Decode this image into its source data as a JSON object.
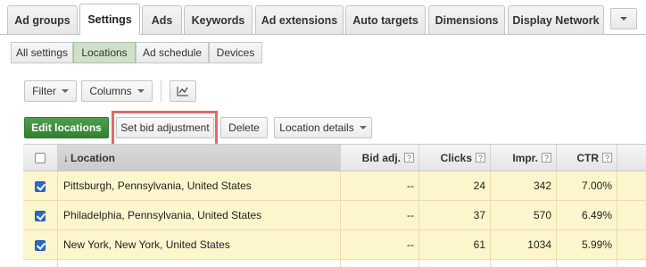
{
  "tabs": [
    {
      "label": "Ad groups"
    },
    {
      "label": "Settings"
    },
    {
      "label": "Ads"
    },
    {
      "label": "Keywords"
    },
    {
      "label": "Ad extensions"
    },
    {
      "label": "Auto targets"
    },
    {
      "label": "Dimensions"
    },
    {
      "label": "Display Network"
    }
  ],
  "active_tab": "Settings",
  "subtabs": [
    {
      "label": "All settings"
    },
    {
      "label": "Locations"
    },
    {
      "label": "Ad schedule"
    },
    {
      "label": "Devices"
    }
  ],
  "active_subtab": "Locations",
  "toolbar": {
    "filter_label": "Filter",
    "columns_label": "Columns",
    "chart_icon": "line-chart-icon"
  },
  "actions": {
    "edit_locations": "Edit locations",
    "set_bid_adjustment": "Set bid adjustment",
    "delete": "Delete",
    "location_details": "Location details"
  },
  "table": {
    "columns": [
      "Location",
      "Bid adj.",
      "Clicks",
      "Impr.",
      "CTR"
    ],
    "help_glyph": "?",
    "sort_glyph": "↓",
    "rows": [
      {
        "location": "Pittsburgh, Pennsylvania, United States",
        "bid_adj": "--",
        "clicks": "24",
        "impr": "342",
        "ctr": "7.00%",
        "checked": true
      },
      {
        "location": "Philadelphia, Pennsylvania, United States",
        "bid_adj": "--",
        "clicks": "37",
        "impr": "570",
        "ctr": "6.49%",
        "checked": true
      },
      {
        "location": "New York, New York, United States",
        "bid_adj": "--",
        "clicks": "61",
        "impr": "1034",
        "ctr": "5.99%",
        "checked": true
      }
    ]
  },
  "colors": {
    "selected_row": "#fdf6cc",
    "primary_button": "#3f8f3f",
    "highlight": "#e8666a",
    "active_subtab": "#cfe0c8"
  }
}
